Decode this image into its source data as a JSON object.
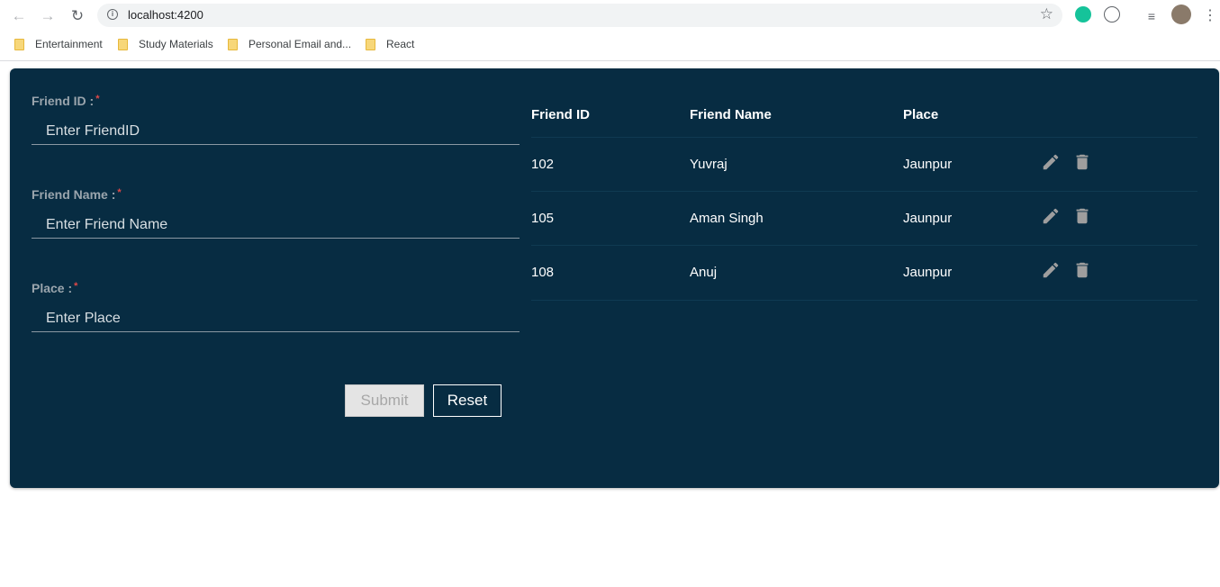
{
  "browser": {
    "url": "localhost:4200",
    "bookmarks": [
      "Entertainment",
      "Study Materials",
      "Personal Email and...",
      "React"
    ]
  },
  "form": {
    "friend_id": {
      "label": "Friend ID :",
      "placeholder": "Enter FriendID",
      "required_mark": "*"
    },
    "friend_name": {
      "label": "Friend Name :",
      "placeholder": "Enter Friend Name",
      "required_mark": "*"
    },
    "place": {
      "label": "Place :",
      "placeholder": "Enter Place",
      "required_mark": "*"
    },
    "submit_label": "Submit",
    "reset_label": "Reset"
  },
  "table": {
    "headers": [
      "Friend ID",
      "Friend Name",
      "Place"
    ],
    "rows": [
      {
        "id": "102",
        "name": "Yuvraj",
        "place": "Jaunpur"
      },
      {
        "id": "105",
        "name": "Aman Singh",
        "place": "Jaunpur"
      },
      {
        "id": "108",
        "name": "Anuj",
        "place": "Jaunpur"
      }
    ],
    "row_action_icons": [
      "pencil-icon",
      "trash-icon"
    ]
  },
  "colors": {
    "card_background": "#072c42",
    "icon_gray": "#9e9e9e",
    "required_red": "#e04848"
  }
}
